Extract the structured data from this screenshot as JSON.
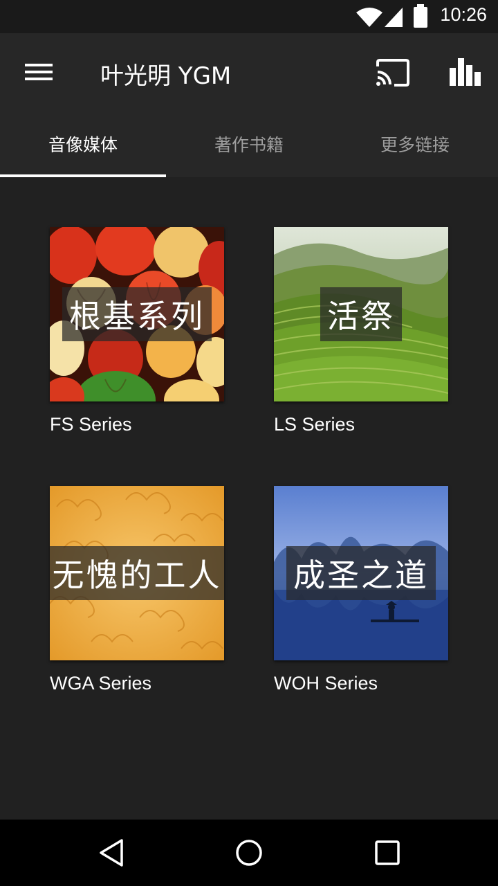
{
  "status_bar": {
    "time": "10:26",
    "icons": [
      "wifi-icon",
      "cell-signal-icon",
      "battery-icon"
    ]
  },
  "app_bar": {
    "title": "叶光明 YGM",
    "icons": [
      "menu-icon",
      "cast-icon",
      "equalizer-icon"
    ]
  },
  "tabs": [
    {
      "label": "音像媒体",
      "active": true
    },
    {
      "label": "著作书籍",
      "active": false
    },
    {
      "label": "更多链接",
      "active": false
    }
  ],
  "series": [
    {
      "overlay": "根基系列",
      "caption": "FS Series",
      "theme": "lanterns"
    },
    {
      "overlay": "活祭",
      "caption": "LS Series",
      "theme": "terraces"
    },
    {
      "overlay": "无愧的工人",
      "caption": "WGA Series",
      "theme": "golden-clouds"
    },
    {
      "overlay": "成圣之道",
      "caption": "WOH Series",
      "theme": "river-fisherman"
    }
  ],
  "nav_bar": {
    "icons": [
      "back-icon",
      "home-icon",
      "recents-icon"
    ]
  },
  "colors": {
    "background": "#212121",
    "app_bar": "#272727",
    "nav_bar": "#000000",
    "tab_inactive": "#9e9e9e"
  }
}
